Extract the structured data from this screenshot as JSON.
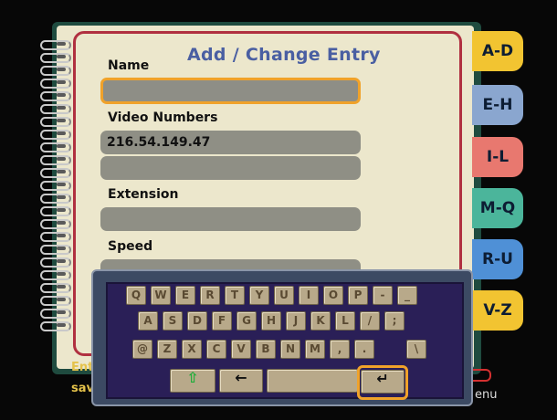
{
  "form": {
    "title": "Add / Change Entry",
    "name_label": "Name",
    "name_value": "",
    "video_numbers_label": "Video Numbers",
    "video_number_1": "216.54.149.47",
    "video_number_2": "",
    "extension_label": "Extension",
    "extension_value": "",
    "speed_label": "Speed"
  },
  "tabs": [
    {
      "label": "A-D",
      "color": "#f2c431"
    },
    {
      "label": "E-H",
      "color": "#8aa6cf"
    },
    {
      "label": "I-L",
      "color": "#e8786f"
    },
    {
      "label": "M-Q",
      "color": "#4bb59b"
    },
    {
      "label": "R-U",
      "color": "#4f90d6"
    },
    {
      "label": "V-Z",
      "color": "#f2c431"
    }
  ],
  "hints": {
    "left_line1": "Ent",
    "left_line2": "sav",
    "right": "enu"
  },
  "keyboard": {
    "row1": [
      "Q",
      "W",
      "E",
      "R",
      "T",
      "Y",
      "U",
      "I",
      "O",
      "P",
      "-",
      "_"
    ],
    "row2": [
      "A",
      "S",
      "D",
      "F",
      "G",
      "H",
      "J",
      "K",
      "L",
      "/",
      ";"
    ],
    "row3": [
      "@",
      "Z",
      "X",
      "C",
      "V",
      "B",
      "N",
      "M",
      ",",
      ".",
      "\\"
    ],
    "shift_symbol": "⇧",
    "backspace_symbol": "←",
    "enter_symbol": "↵"
  },
  "colors": {
    "accent_focus": "#f0a22a",
    "title_blue": "#4a5fa2",
    "page_border": "#b03040"
  }
}
